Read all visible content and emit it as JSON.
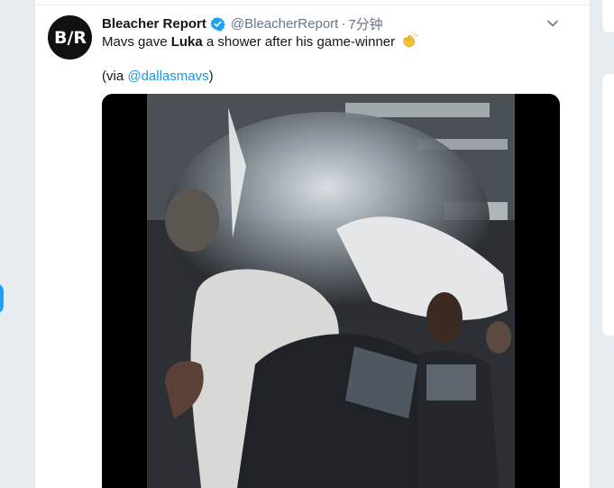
{
  "tweet": {
    "display_name": "Bleacher Report",
    "handle": "@BleacherReport",
    "separator": "·",
    "timestamp": "7分钟",
    "avatar_text": {
      "left": "B",
      "slash": "/",
      "right": "R"
    },
    "text_before": "Mavs gave ",
    "text_bold": "Luka",
    "text_after": " a shower after his game-winner",
    "via_open": "(via ",
    "via_mention": "@dallasmavs",
    "via_close": ")",
    "media_description": "video-thumbnail"
  },
  "icons": {
    "verified": "verified-badge-icon",
    "more": "chevron-down-icon",
    "emoji": "clapping-hands-emoji"
  },
  "colors": {
    "accent": "#1da1f2",
    "link": "#1b95e0",
    "secondary_text": "#657786",
    "page_background": "#e6ecf0"
  }
}
